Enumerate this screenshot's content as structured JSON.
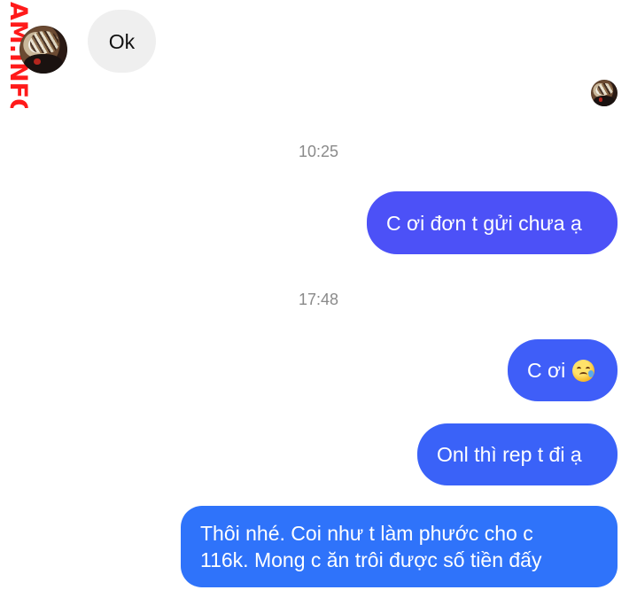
{
  "watermark": {
    "text": "AM.INFO",
    "color": "#ff1a1a"
  },
  "messages": {
    "incoming_ok": "Ok",
    "time_1": "10:25",
    "out_1": "C ơi đơn t gửi chưa ạ",
    "time_2": "17:48",
    "out_2": "C ơi",
    "out_2_emoji": "crying-face-emoji",
    "out_3": "Onl thì rep t đi ạ",
    "out_4_line_1": "Thôi nhé. Coi như t làm phước cho c",
    "out_4_line_2": "116k. Mong c ăn trôi được số tiền đấy"
  },
  "colors": {
    "incoming_bubble": "#efefef",
    "outgoing_bubble_top": "#4c51f7",
    "outgoing_bubble_bottom": "#2f73fa",
    "timestamp": "#8a8a8a"
  }
}
